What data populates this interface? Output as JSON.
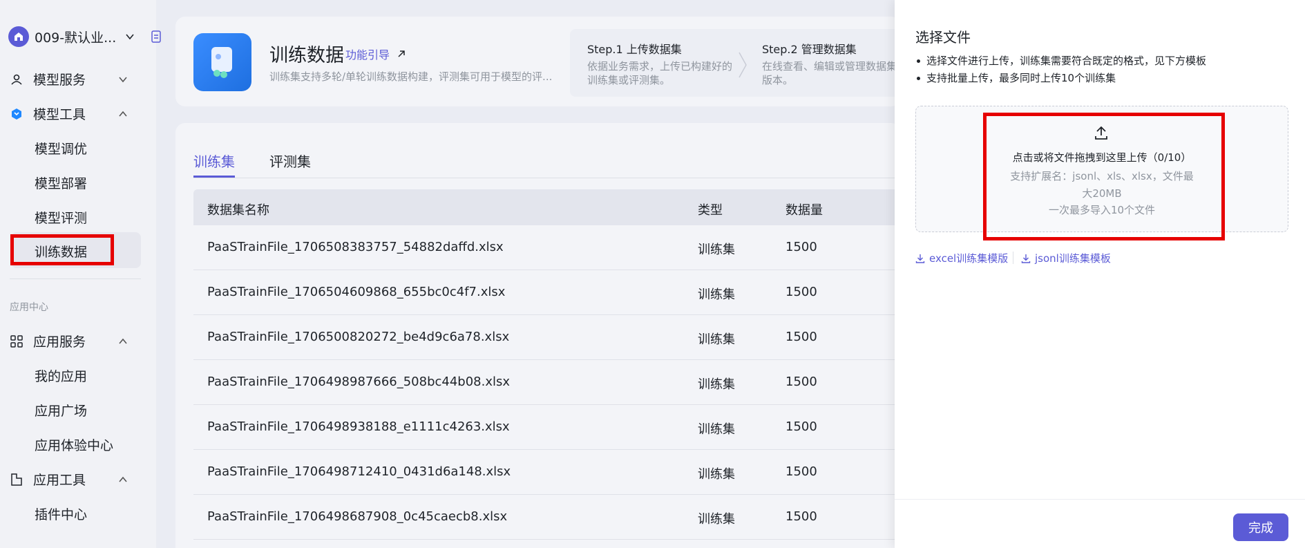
{
  "sidebar": {
    "workspace_name": "009-默认业...",
    "groups": {
      "model_service": "模型服务",
      "model_tools": "模型工具",
      "app_services": "应用服务",
      "app_tools": "应用工具"
    },
    "model_tools_items": [
      "模型调优",
      "模型部署",
      "模型评测",
      "训练数据"
    ],
    "section_label": "应用中心",
    "app_services_items": [
      "我的应用",
      "应用广场",
      "应用体验中心"
    ],
    "app_tools_items": [
      "插件中心"
    ],
    "active_item": "训练数据"
  },
  "header": {
    "title": "训练数据",
    "guide_link": "功能引导",
    "description": "训练集支持多轮/单轮训练数据构建，评测集可用于模型的评...",
    "step1_title": "Step.1 上传数据集",
    "step1_desc": "依据业务需求，上传已构建好的训练集或评测集。",
    "step2_title": "Step.2 管理数据集",
    "step2_desc": "在线查看、编辑或管理数据集版本。"
  },
  "tabs": [
    "训练集",
    "评测集"
  ],
  "active_tab": "训练集",
  "table": {
    "columns": [
      "数据集名称",
      "类型",
      "数据量"
    ],
    "rows": [
      {
        "name": "PaaSTrainFile_1706508383757_54882daffd.xlsx",
        "type": "训练集",
        "count": "1500"
      },
      {
        "name": "PaaSTrainFile_1706504609868_655bc0c4f7.xlsx",
        "type": "训练集",
        "count": "1500"
      },
      {
        "name": "PaaSTrainFile_1706500820272_be4d9c6a78.xlsx",
        "type": "训练集",
        "count": "1500"
      },
      {
        "name": "PaaSTrainFile_1706498987666_508bc44b08.xlsx",
        "type": "训练集",
        "count": "1500"
      },
      {
        "name": "PaaSTrainFile_1706498938188_e1111c4263.xlsx",
        "type": "训练集",
        "count": "1500"
      },
      {
        "name": "PaaSTrainFile_1706498712410_0431d6a148.xlsx",
        "type": "训练集",
        "count": "1500"
      },
      {
        "name": "PaaSTrainFile_1706498687908_0c45caecb8.xlsx",
        "type": "训练集",
        "count": "1500"
      }
    ]
  },
  "drawer": {
    "title": "选择文件",
    "bullets": [
      "选择文件进行上传，训练集需要符合既定的格式，见下方模板",
      "支持批量上传，最多同时上传10个训练集"
    ],
    "dropzone_main": "点击或将文件拖拽到这里上传（0/10）",
    "dropzone_ext": "支持扩展名：jsonl、xls、xlsx，文件最大20MB",
    "dropzone_limit": "一次最多导入10个文件",
    "template_excel": "excel训练集模版",
    "template_jsonl": "jsonl训练集模板",
    "done_button": "完成"
  },
  "colors": {
    "accent": "#5b5bd6",
    "highlight": "#e60000"
  }
}
